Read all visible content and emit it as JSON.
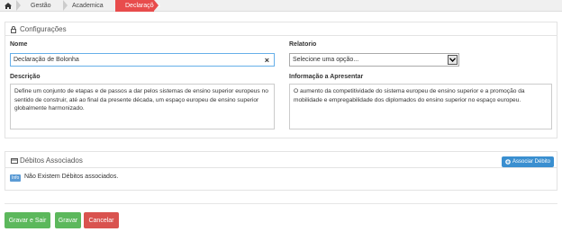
{
  "breadcrumb": {
    "items": [
      "Gestão",
      "Academica"
    ],
    "active": "Declarações"
  },
  "config": {
    "title": "Configurações",
    "nome_label": "Nome",
    "nome_value": "Declaração de Bolonha",
    "relatorio_label": "Relatorio",
    "relatorio_value": "Selecione uma opção...",
    "descricao_label": "Descrição",
    "descricao_value": "Define um conjunto de etapas e de passos a dar pelos sistemas de ensino superior europeus no sentido de construir, até ao final da presente década, um espaço europeu de ensino superior globalmente harmonizado.",
    "info_label": "Informação a Apresentar",
    "info_value": "O aumento da competitividade do sistema europeu de ensino superior e a promoção da mobilidade e empregabilidade dos diplomados do ensino superior no espaço europeu."
  },
  "debitos": {
    "title": "Débitos Associados",
    "assoc_button": "Associar Débito",
    "info_badge": "Info",
    "empty_text": "Não Existem Débitos associados."
  },
  "actions": {
    "save_exit": "Gravar e Sair",
    "save": "Gravar",
    "cancel": "Cancelar"
  }
}
